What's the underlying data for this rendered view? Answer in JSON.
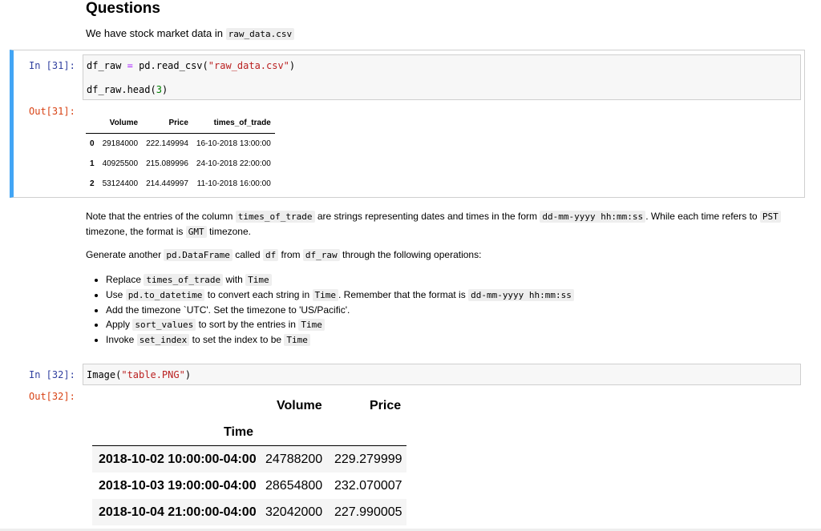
{
  "markdown_top": {
    "title": "Questions",
    "intro_text": "We have stock market data in",
    "intro_code": "raw_data.csv"
  },
  "cell31": {
    "in_prompt": "In [31]:",
    "out_prompt": "Out[31]:",
    "code_line1": {
      "var": "df_raw",
      "op": "=",
      "call": "pd.read_csv(",
      "arg": "\"raw_data.csv\"",
      "close": ")"
    },
    "code_line2": {
      "call": "df_raw.head(",
      "arg": "3",
      "close": ")"
    },
    "table": {
      "columns": [
        "",
        "Volume",
        "Price",
        "times_of_trade"
      ],
      "rows": [
        {
          "index": "0",
          "volume": "29184000",
          "price": "222.149994",
          "time": "16-10-2018 13:00:00"
        },
        {
          "index": "1",
          "volume": "40925500",
          "price": "215.089996",
          "time": "24-10-2018 22:00:00"
        },
        {
          "index": "2",
          "volume": "53124400",
          "price": "214.449997",
          "time": "11-10-2018 16:00:00"
        }
      ]
    }
  },
  "markdown_mid": {
    "note": {
      "t1": "Note that the entries of the column",
      "c1": "times_of_trade",
      "t2": "are strings representing dates and times in the form",
      "c2": "dd-mm-yyyy hh:mm:ss",
      "t3": ". While each time refers to",
      "c3": "PST",
      "t4": "timezone, the format is",
      "c4": "GMT",
      "t5": "timezone."
    },
    "generate": {
      "t1": "Generate another",
      "c1": "pd.DataFrame",
      "t2": "called",
      "c2": "df",
      "t3": "from",
      "c3": "df_raw",
      "t4": "through the following operations:"
    },
    "ops": [
      {
        "t1": "Replace",
        "c1": "times_of_trade",
        "t2": "with",
        "c2": "Time",
        "t3": ""
      },
      {
        "t1": "Use",
        "c1": "pd.to_datetime",
        "t2": "to convert each string in",
        "c2": "Time",
        "t3": ". Remember that the format is",
        "c3": "dd-mm-yyyy hh:mm:ss"
      },
      {
        "t1": "Add the timezone `UTC'. Set the timezone to 'US/Pacific'."
      },
      {
        "t1": "Apply",
        "c1": "sort_values",
        "t2": "to sort by the entries in",
        "c2": "Time"
      },
      {
        "t1": "Invoke",
        "c1": "set_index",
        "t2": "to set the index to be",
        "c2": "Time"
      }
    ]
  },
  "cell32": {
    "in_prompt": "In [32]:",
    "out_prompt": "Out[32]:",
    "code": {
      "call": "Image(",
      "arg": "\"table.PNG\"",
      "close": ")"
    },
    "image_table": {
      "col_volume": "Volume",
      "col_price": "Price",
      "index_name": "Time",
      "rows": [
        {
          "time": "2018-10-02 10:00:00-04:00",
          "volume": "24788200",
          "price": "229.279999"
        },
        {
          "time": "2018-10-03 19:00:00-04:00",
          "volume": "28654800",
          "price": "232.070007"
        },
        {
          "time": "2018-10-04 21:00:00-04:00",
          "volume": "32042000",
          "price": "227.990005"
        }
      ]
    }
  },
  "colors": {
    "selected_cell_border": "#42a5f5",
    "in_prompt": "#303f9f",
    "out_prompt": "#d84315",
    "string_literal": "#ba2121",
    "number_literal": "#008000",
    "operator": "#aa22ff"
  }
}
